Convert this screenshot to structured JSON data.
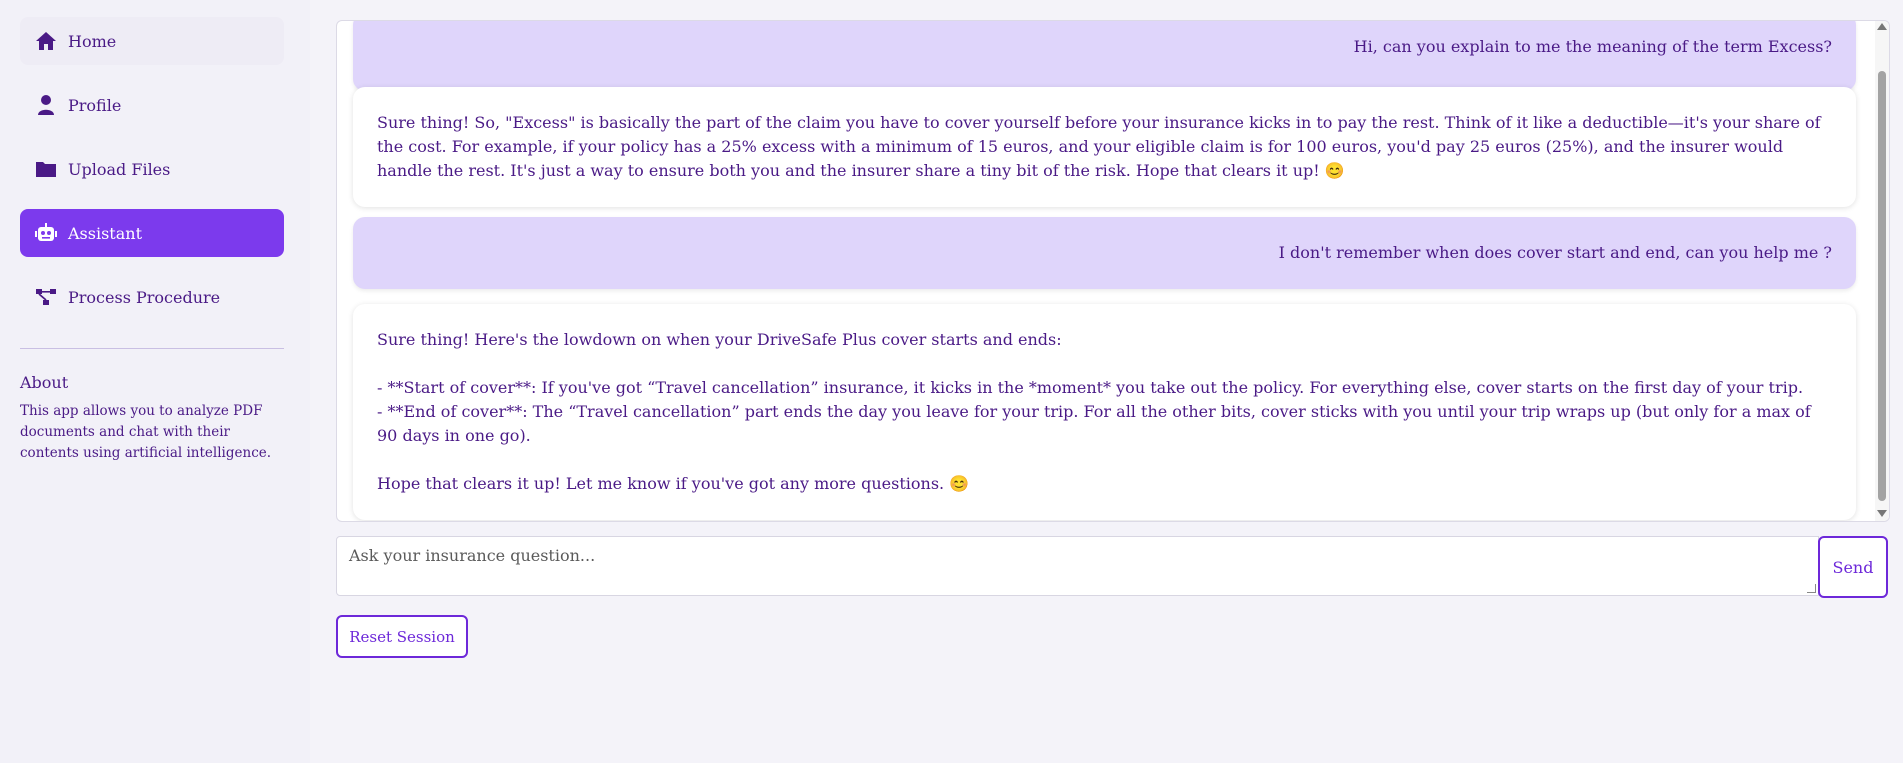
{
  "sidebar": {
    "items": [
      {
        "label": "Home",
        "icon": "home-icon"
      },
      {
        "label": "Profile",
        "icon": "user-icon"
      },
      {
        "label": "Upload Files",
        "icon": "folder-icon"
      },
      {
        "label": "Assistant",
        "icon": "robot-icon",
        "active": true
      },
      {
        "label": "Process Procedure",
        "icon": "flow-icon"
      }
    ],
    "about_title": "About",
    "about_text": "This app allows you to analyze PDF documents and chat with their contents using artificial intelligence."
  },
  "chat": {
    "messages": [
      {
        "role": "user",
        "text": "Hi, can you explain to me the meaning of the term Excess?"
      },
      {
        "role": "assistant",
        "text": "Sure thing! So, \"Excess\" is basically the part of the claim you have to cover yourself before your insurance kicks in to pay the rest. Think of it like a deductible—it's your share of the cost. For example, if your policy has a 25% excess with a minimum of 15 euros, and your eligible claim is for 100 euros, you'd pay 25 euros (25%), and the insurer would handle the rest. It's just a way to ensure both you and the insurer share a tiny bit of the risk. Hope that clears it up! 😊"
      },
      {
        "role": "user",
        "text": "I don't remember when does cover start and end, can you help me ?"
      },
      {
        "role": "assistant",
        "text": "Sure thing! Here's the lowdown on when your DriveSafe Plus cover starts and ends:\n\n- **Start of cover**: If you've got “Travel cancellation” insurance, it kicks in the *moment* you take out the policy. For everything else, cover starts on the first day of your trip.\n- **End of cover**: The “Travel cancellation” part ends the day you leave for your trip. For all the other bits, cover sticks with you until your trip wraps up (but only for a max of 90 days in one go).\n\nHope that clears it up! Let me know if you've got any more questions. 😊"
      }
    ]
  },
  "input": {
    "placeholder": "Ask your insurance question...",
    "value": ""
  },
  "send_label": "Send",
  "reset_label": "Reset Session",
  "colors": {
    "accent": "#7c3aed",
    "text": "#4a1a86",
    "user_bubble": "#dfd5fb",
    "background": "#f4f3f9"
  }
}
